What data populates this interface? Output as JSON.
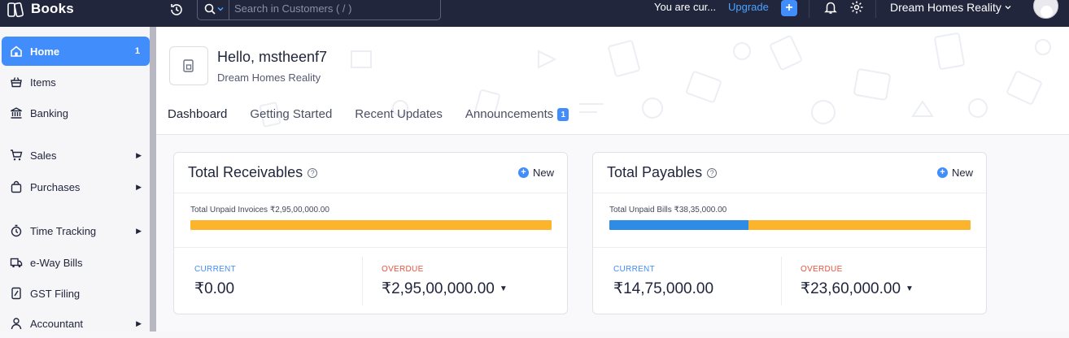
{
  "app": {
    "name": "Books"
  },
  "search": {
    "placeholder": "Search in Customers ( / )"
  },
  "topbar": {
    "trial_text": "You are cur...",
    "upgrade_label": "Upgrade",
    "quick_add_label": "+",
    "org_name": "Dream Homes Reality"
  },
  "sidebar": {
    "items": [
      {
        "label": "Home",
        "count": "1",
        "icon": "home-icon",
        "active": true
      },
      {
        "label": "Items",
        "icon": "items-basket-icon"
      },
      {
        "label": "Banking",
        "icon": "bank-icon"
      },
      {
        "label": "Sales",
        "icon": "cart-icon",
        "has_submenu": true
      },
      {
        "label": "Purchases",
        "icon": "shopping-bag-icon",
        "has_submenu": true
      },
      {
        "label": "Time Tracking",
        "icon": "stopwatch-icon",
        "has_submenu": true
      },
      {
        "label": "e-Way Bills",
        "icon": "truck-icon"
      },
      {
        "label": "GST Filing",
        "icon": "gst-document-icon"
      },
      {
        "label": "Accountant",
        "icon": "accountant-icon",
        "has_submenu": true
      }
    ]
  },
  "header": {
    "greeting": "Hello, mstheenf7",
    "org_name": "Dream Homes Reality",
    "tabs": [
      {
        "label": "Dashboard",
        "active": true
      },
      {
        "label": "Getting Started"
      },
      {
        "label": "Recent Updates"
      },
      {
        "label": "Announcements",
        "badge": "1"
      }
    ]
  },
  "receivables": {
    "title": "Total Receivables",
    "new_label": "New",
    "unpaid_label": "Total Unpaid Invoices ₹2,95,00,000.00",
    "current_label": "CURRENT",
    "current_value": "₹0.00",
    "current_fraction": 0,
    "overdue_label": "OVERDUE",
    "overdue_value": "₹2,95,00,000.00"
  },
  "payables": {
    "title": "Total Payables",
    "new_label": "New",
    "unpaid_label": "Total Unpaid Bills ₹38,35,000.00",
    "current_label": "CURRENT",
    "current_value": "₹14,75,000.00",
    "current_fraction": 0.3846,
    "overdue_label": "OVERDUE",
    "overdue_value": "₹23,60,000.00"
  },
  "colors": {
    "accent": "#408dfb",
    "topbar": "#21263c",
    "current_bar": "#2f8ce6",
    "overdue_bar": "#fbb42c",
    "overdue_text": "#e8543f"
  }
}
